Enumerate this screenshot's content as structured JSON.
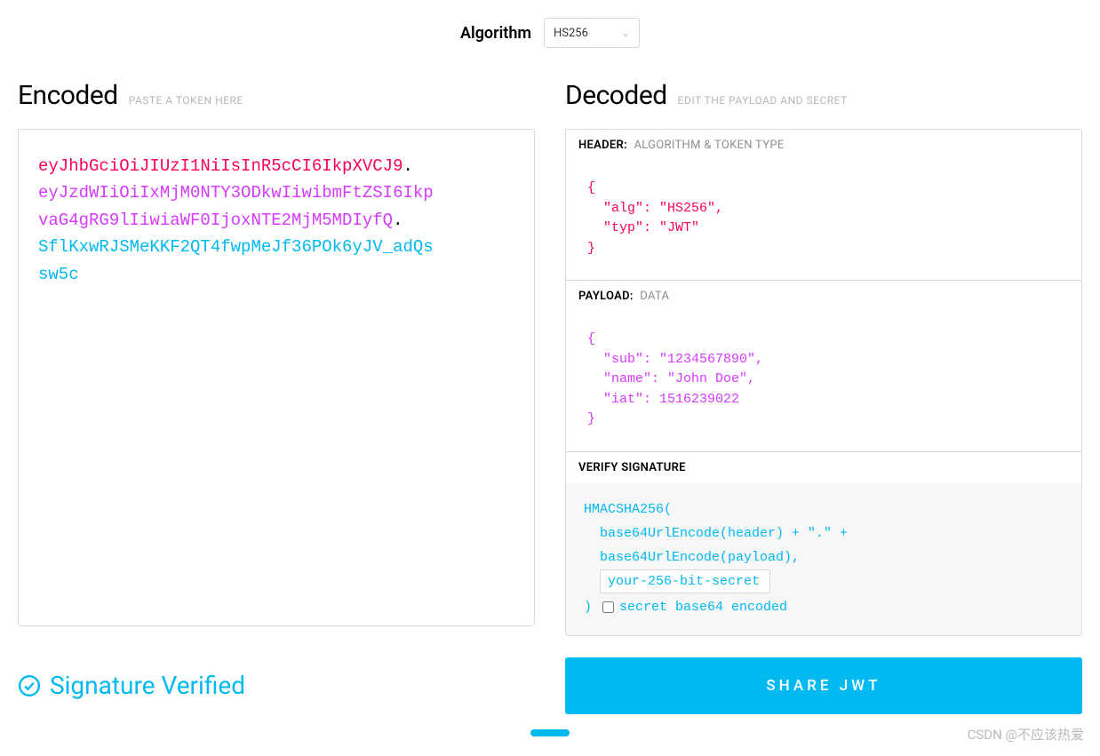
{
  "algo": {
    "label": "Algorithm",
    "selected": "HS256"
  },
  "encoded": {
    "title": "Encoded",
    "sub": "PASTE A TOKEN HERE",
    "header": "eyJhbGciOiJIUzI1NiIsInR5cCI6IkpXVCJ9",
    "payload_l1": "eyJzdWIiOiIxMjM0NTY3ODkwIiwibmFtZSI6Ikp",
    "payload_l2": "vaG4gRG9lIiwiaWF0IjoxNTE2MjM5MDIyfQ",
    "sig_l1": "SflKxwRJSMeKKF2QT4fwpMeJf36POk6yJV_adQs",
    "sig_l2": "sw5c",
    "dot": "."
  },
  "decoded": {
    "title": "Decoded",
    "sub": "EDIT THE PAYLOAD AND SECRET",
    "header": {
      "strong": "HEADER:",
      "weak": "ALGORITHM & TOKEN TYPE",
      "body": "{\n  \"alg\": \"HS256\",\n  \"typ\": \"JWT\"\n}"
    },
    "payload": {
      "strong": "PAYLOAD:",
      "weak": "DATA",
      "body": "{\n  \"sub\": \"1234567890\",\n  \"name\": \"John Doe\",\n  \"iat\": 1516239022\n}"
    },
    "signature": {
      "strong": "VERIFY SIGNATURE",
      "fn": "HMACSHA256(",
      "l1": "base64UrlEncode(header) + \".\" +",
      "l2": "base64UrlEncode(payload),",
      "secret": "your-256-bit-secret",
      "close": ")",
      "b64_label": "secret base64 encoded"
    }
  },
  "verified": "Signature Verified",
  "share": "SHARE JWT",
  "watermark": "CSDN @不应该热爱"
}
